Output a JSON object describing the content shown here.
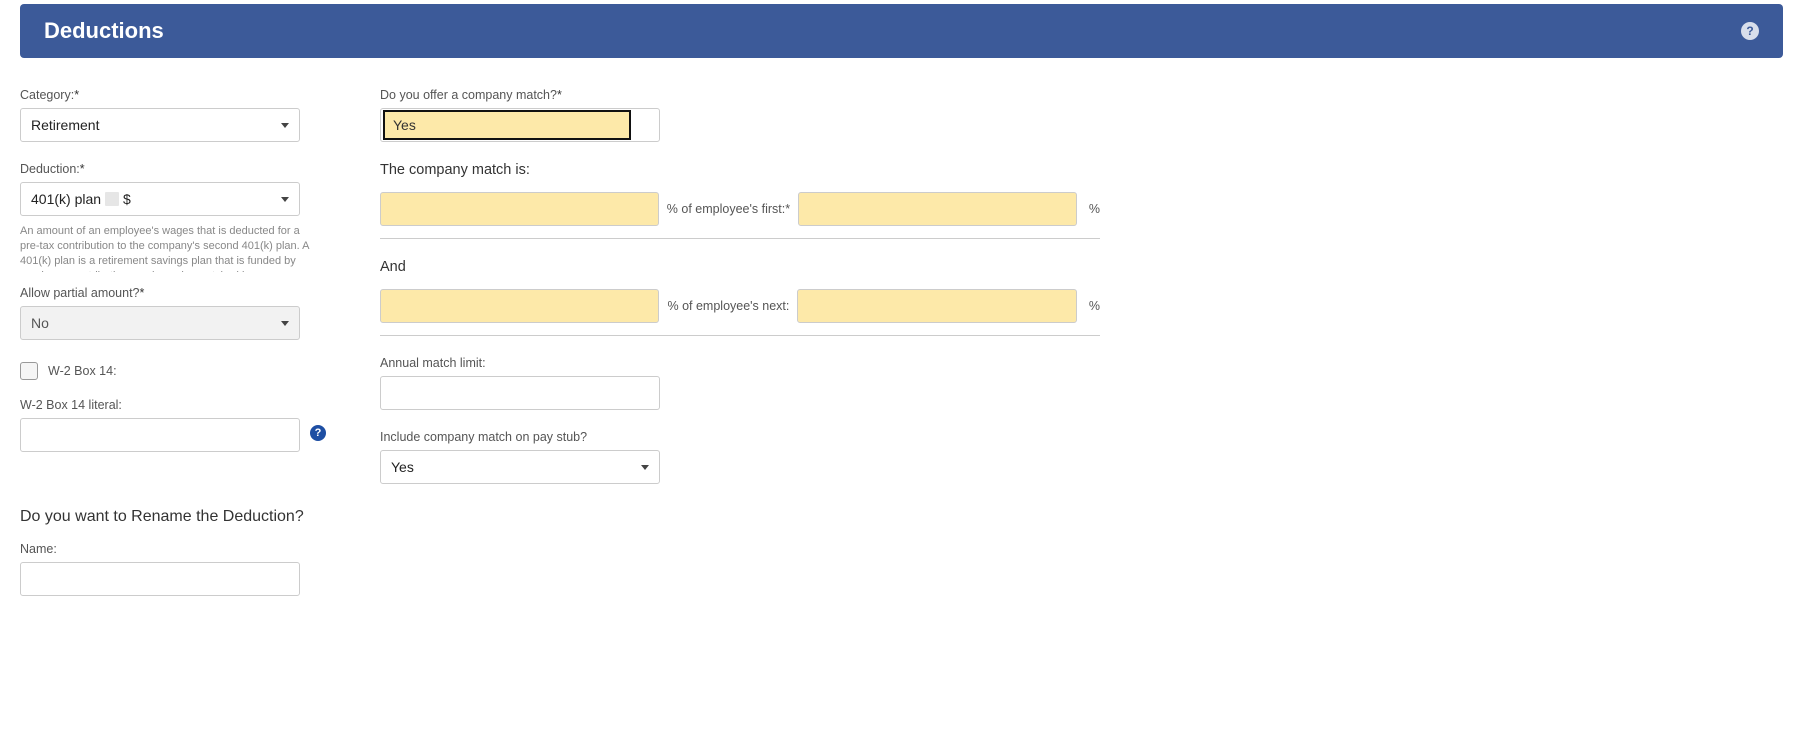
{
  "header": {
    "title": "Deductions"
  },
  "left": {
    "category_label": "Category:",
    "category_value": "Retirement",
    "deduction_label": "Deduction:",
    "deduction_value_prefix": "401(k) plan",
    "deduction_value_suffix": "$",
    "desc_text": "An amount of an employee's wages that is deducted for a pre-tax contribution to the company's second 401(k) plan. A 401(k) plan is a retirement savings plan that is funded by employee contributions and may be matched by contributions from the employer.",
    "allow_partial_label": "Allow partial amount?",
    "allow_partial_value": "No",
    "w2_box14_checkbox_label": "W-2 Box 14:",
    "w2_box14_literal_label": "W-2 Box 14 literal:",
    "rename_heading": "Do you want to Rename the Deduction?",
    "name_label": "Name:"
  },
  "right": {
    "offer_match_label": "Do you offer a company match?",
    "offer_match_value": "Yes",
    "match_is_label": "The company match is:",
    "emp_first_label": "% of employee's first:",
    "and_label": "And",
    "emp_next_label": "% of employee's next:",
    "pct_label": "%",
    "annual_limit_label": "Annual match limit:",
    "include_paystub_label": "Include company match on pay stub?",
    "include_paystub_value": "Yes"
  },
  "required_mark": "*"
}
